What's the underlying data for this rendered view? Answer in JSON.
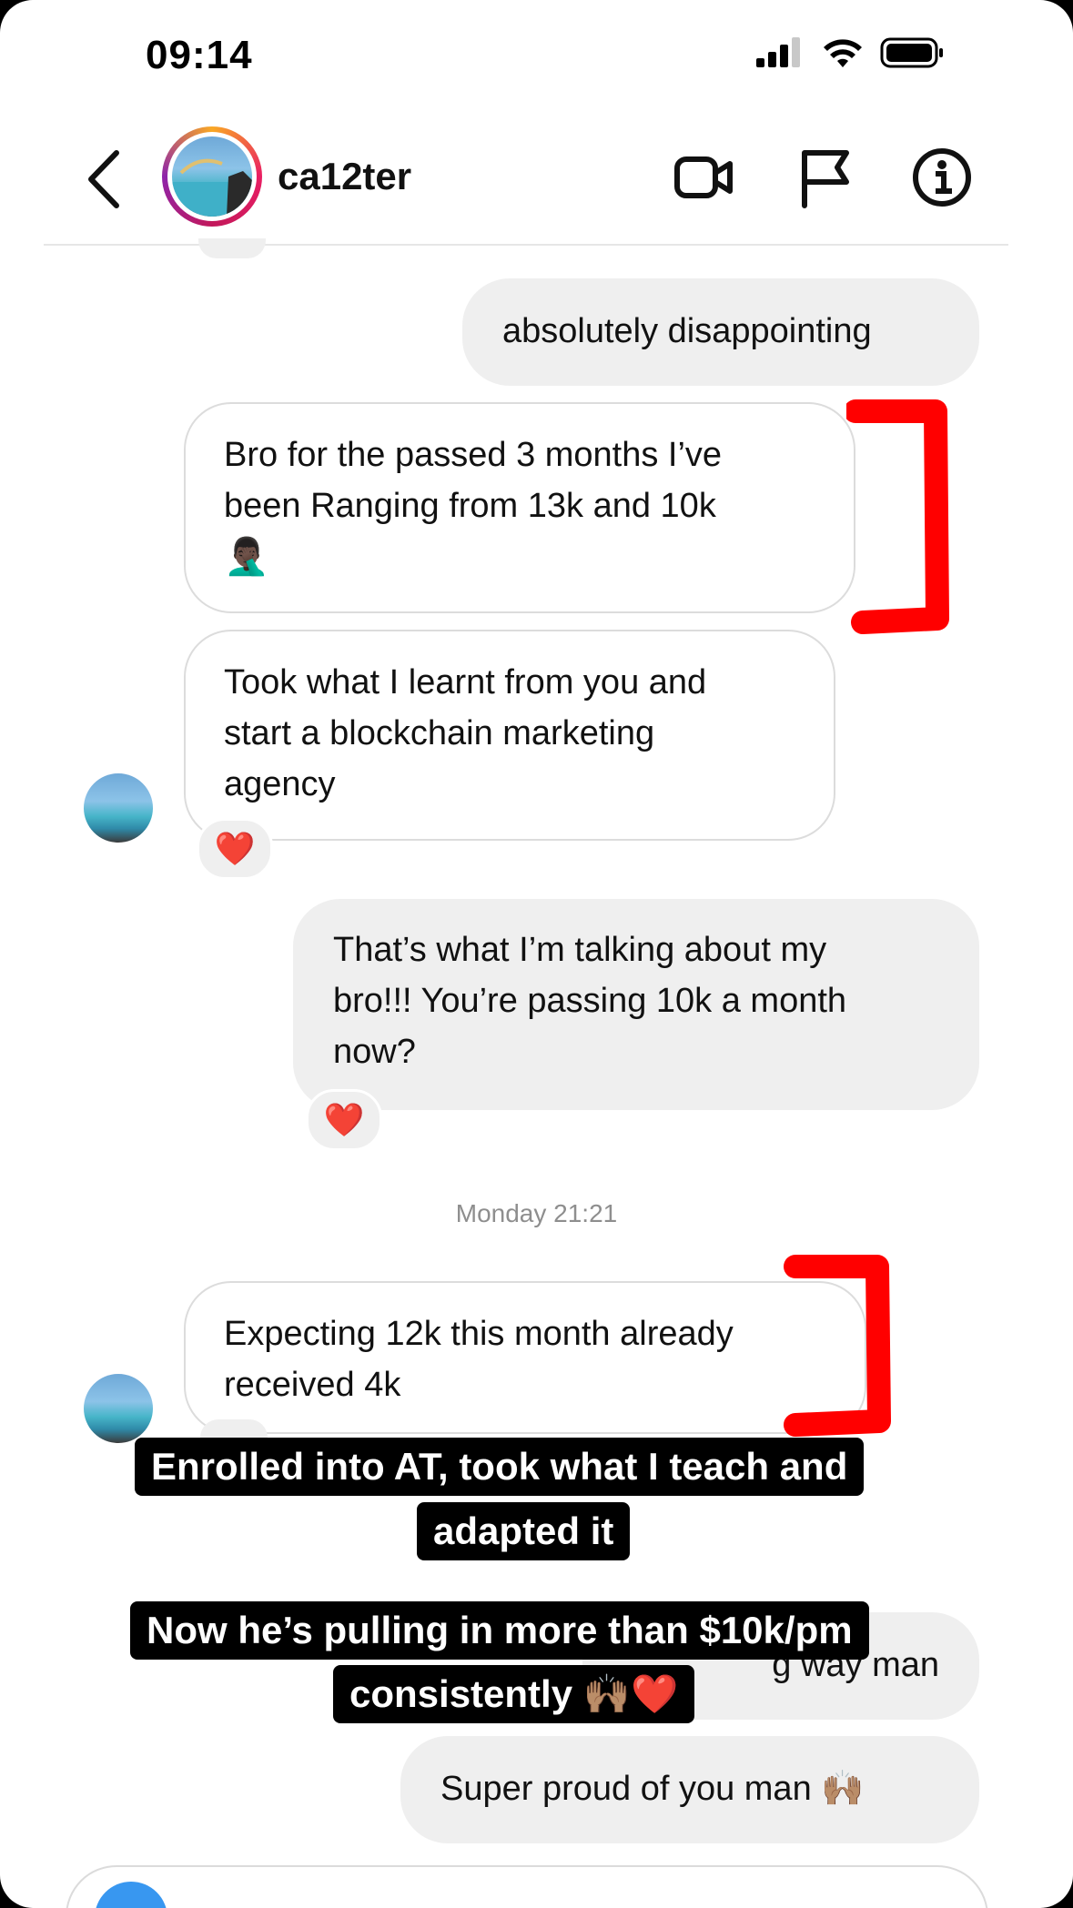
{
  "status_bar": {
    "time": "09:14"
  },
  "header": {
    "username": "ca12ter"
  },
  "messages": [
    {
      "text_lines": [
        "absolutely disappointing"
      ]
    },
    {
      "text_lines": [
        "Bro for the passed 3 months I’ve",
        "been Ranging from 13k and 10k",
        "🤦🏿‍♂️"
      ]
    },
    {
      "text_lines": [
        "Took what I learnt from you and",
        "start a blockchain marketing",
        "agency"
      ],
      "reaction": "❤️"
    },
    {
      "text_lines": [
        "That’s what I’m talking about my",
        "bro!!! You’re passing 10k a month",
        "now?"
      ],
      "reaction": "❤️"
    },
    {
      "text_lines": [
        "Expecting 12k this month already",
        "received 4k"
      ]
    },
    {
      "text_lines": [
        "g way man"
      ]
    },
    {
      "text_lines": [
        "Super proud of you man 🙌🏽"
      ]
    }
  ],
  "timestamp": "Monday 21:21",
  "captions": {
    "line1": "Enrolled into AT, took what I teach and",
    "line2": "adapted it",
    "line3": "Now he’s pulling in more than $10k/pm",
    "line4": "consistently 🙌🏽❤️"
  },
  "icons": [
    "back-chevron-icon",
    "video-call-icon",
    "flag-icon",
    "info-icon",
    "cellular-signal-icon",
    "wifi-icon",
    "battery-icon",
    "camera-icon"
  ],
  "colors": {
    "outgoing_bubble": "#efefef",
    "annotation_red": "#ff0000",
    "caption_bg": "#000000",
    "caption_text": "#ffffff"
  }
}
